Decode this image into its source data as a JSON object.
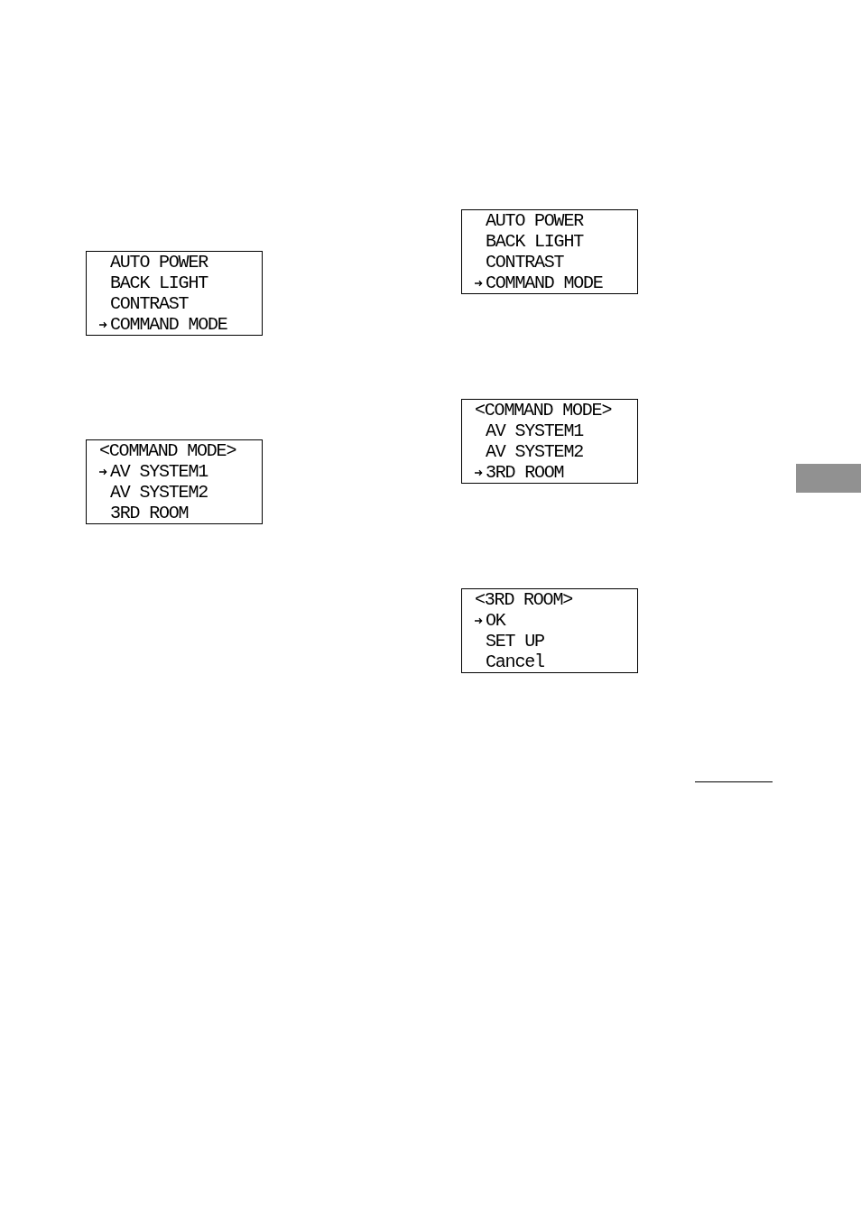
{
  "left_column": {
    "displays": [
      {
        "items": [
          {
            "label": "AUTO POWER",
            "selected": false
          },
          {
            "label": "BACK LIGHT",
            "selected": false
          },
          {
            "label": "CONTRAST",
            "selected": false
          },
          {
            "label": "COMMAND MODE",
            "selected": true
          }
        ]
      },
      {
        "title": "<COMMAND MODE>",
        "items": [
          {
            "label": "AV SYSTEM1",
            "selected": true
          },
          {
            "label": "AV SYSTEM2",
            "selected": false
          },
          {
            "label": "3RD ROOM",
            "selected": false
          }
        ]
      }
    ]
  },
  "right_column": {
    "displays": [
      {
        "items": [
          {
            "label": "AUTO POWER",
            "selected": false
          },
          {
            "label": "BACK LIGHT",
            "selected": false
          },
          {
            "label": "CONTRAST",
            "selected": false
          },
          {
            "label": "COMMAND MODE",
            "selected": true
          }
        ]
      },
      {
        "title": "<COMMAND MODE>",
        "items": [
          {
            "label": "AV SYSTEM1",
            "selected": false
          },
          {
            "label": "AV SYSTEM2",
            "selected": false
          },
          {
            "label": "3RD ROOM",
            "selected": true
          }
        ]
      },
      {
        "title": "<3RD ROOM>",
        "items": [
          {
            "label": "OK",
            "selected": true
          },
          {
            "label": "SET UP",
            "selected": false
          },
          {
            "label": "Cancel",
            "selected": false
          }
        ]
      }
    ]
  }
}
